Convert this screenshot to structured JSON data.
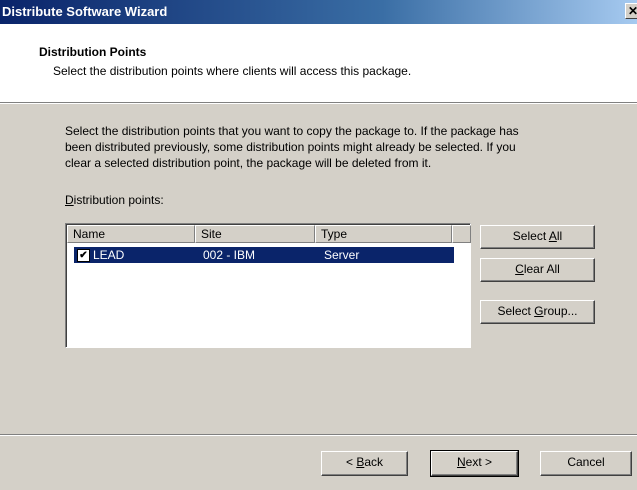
{
  "window": {
    "title": "Distribute Software Wizard",
    "close_glyph": "✕"
  },
  "header": {
    "title": "Distribution Points",
    "subtitle": "Select the distribution points where clients will access this package."
  },
  "body": {
    "description_lines": [
      "Select the distribution points that you want to copy the package to. If the package has",
      "been distributed previously, some distribution points might already be selected. If you",
      "clear a selected distribution point, the package will be deleted from it."
    ],
    "list_label": {
      "accel": "D",
      "rest": "istribution points:"
    }
  },
  "list": {
    "columns": [
      "Name",
      "Site",
      "Type"
    ],
    "rows": [
      {
        "checked": true,
        "check_glyph": "✔",
        "name": "LEAD",
        "site": "002 - IBM",
        "type": "Server",
        "selected": true
      }
    ]
  },
  "side_buttons": {
    "select_all": {
      "pre": "Select ",
      "accel": "A",
      "post": "ll"
    },
    "clear_all": {
      "pre": "",
      "accel": "C",
      "post": "lear All"
    },
    "select_group": {
      "pre": "Select ",
      "accel": "G",
      "post": "roup..."
    }
  },
  "nav_buttons": {
    "back": {
      "pre": "< ",
      "accel": "B",
      "post": "ack"
    },
    "next": {
      "pre": "",
      "accel": "N",
      "post": "ext >"
    },
    "cancel": {
      "pre": "Cancel",
      "accel": "",
      "post": ""
    }
  }
}
